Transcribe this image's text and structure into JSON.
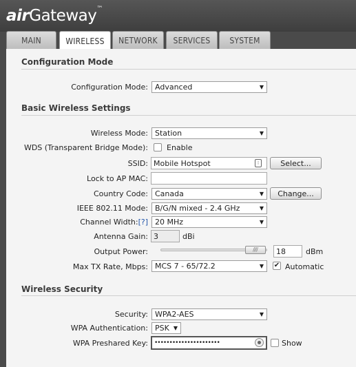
{
  "brand": {
    "prefix": "air",
    "name": "Gateway",
    "mark": "™"
  },
  "tabs": [
    {
      "label": "MAIN"
    },
    {
      "label": "WIRELESS",
      "active": true
    },
    {
      "label": "NETWORK"
    },
    {
      "label": "SERVICES"
    },
    {
      "label": "SYSTEM"
    }
  ],
  "config_mode": {
    "section_title": "Configuration Mode",
    "label": "Configuration Mode:",
    "value": "Advanced"
  },
  "basic": {
    "section_title": "Basic Wireless Settings",
    "wireless_mode": {
      "label": "Wireless Mode:",
      "value": "Station"
    },
    "wds": {
      "label": "WDS (Transparent Bridge Mode):",
      "checked": false,
      "option": "Enable"
    },
    "ssid": {
      "label": "SSID:",
      "value": "Mobile Hotspot",
      "button": "Select..."
    },
    "lock_ap": {
      "label": "Lock to AP MAC:",
      "value": ""
    },
    "country": {
      "label": "Country Code:",
      "value": "Canada",
      "button": "Change..."
    },
    "ieee_mode": {
      "label": "IEEE 802.11 Mode:",
      "value": "B/G/N mixed - 2.4 GHz"
    },
    "channel_width": {
      "label": "Channel Width:",
      "help": "[?]",
      "value": "20 MHz"
    },
    "antenna_gain": {
      "label": "Antenna Gain:",
      "value": "3",
      "unit": "dBi"
    },
    "output_power": {
      "label": "Output Power:",
      "value": "18",
      "unit": "dBm",
      "level": 0.98
    },
    "max_tx": {
      "label": "Max TX Rate, Mbps:",
      "value": "MCS 7 - 65/72.2",
      "auto_checked": true,
      "auto_label": "Automatic"
    }
  },
  "security": {
    "section_title": "Wireless Security",
    "security": {
      "label": "Security:",
      "value": "WPA2-AES"
    },
    "wpa_auth": {
      "label": "WPA Authentication:",
      "value": "PSK"
    },
    "psk": {
      "label": "WPA Preshared Key:",
      "value": "••••••••••••••••••••••",
      "show_checked": false,
      "show_label": "Show"
    }
  },
  "colors": {
    "header": "#4a4a4a",
    "panel": "#f4f4f4",
    "help_link": "#2255aa"
  }
}
